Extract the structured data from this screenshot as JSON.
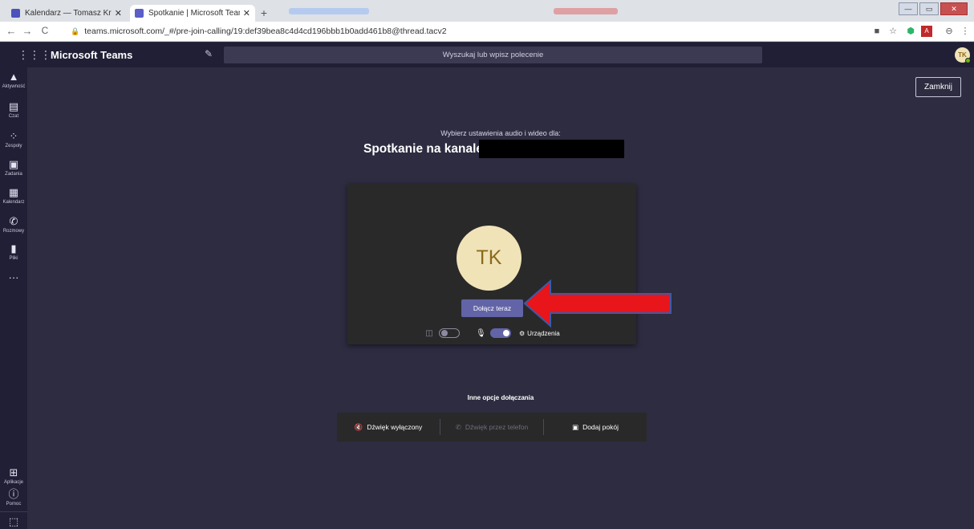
{
  "browser": {
    "tabs": [
      {
        "title": "Kalendarz — Tomasz Kretowicz -",
        "favicon_color": "#4b53bc",
        "active": false
      },
      {
        "title": "Spotkanie | Microsoft Teams",
        "favicon_color": "#5b5fc7",
        "active": true
      }
    ],
    "new_tab": "+",
    "url": "teams.microsoft.com/_#/pre-join-calling/19:def39bea8c4d4cd196bbb1b0add461b8@thread.tacv2"
  },
  "teams": {
    "brand": "Microsoft Teams",
    "search_placeholder": "Wyszukaj lub wpisz polecenie",
    "user_initials": "TK",
    "rail": [
      {
        "label": "Aktywność",
        "icon": "bell-icon",
        "glyph": "🔔"
      },
      {
        "label": "Czat",
        "icon": "chat-icon",
        "glyph": "💬"
      },
      {
        "label": "Zespoły",
        "icon": "teams-icon",
        "glyph": "👥"
      },
      {
        "label": "Zadania",
        "icon": "tasks-icon",
        "glyph": "🗒"
      },
      {
        "label": "Kalendarz",
        "icon": "calendar-icon",
        "glyph": "📅"
      },
      {
        "label": "Rozmowy",
        "icon": "phone-icon",
        "glyph": "📞"
      },
      {
        "label": "Pliki",
        "icon": "files-icon",
        "glyph": "📄"
      },
      {
        "label": "",
        "icon": "more-icon",
        "glyph": "···"
      }
    ],
    "rail_bottom": [
      {
        "label": "Aplikacje",
        "icon": "apps-icon",
        "glyph": "⊞"
      },
      {
        "label": "Pomoc",
        "icon": "help-icon",
        "glyph": "?"
      }
    ]
  },
  "prejoin": {
    "close_label": "Zamknij",
    "prompt": "Wybierz ustawienia audio i wideo dla:",
    "meeting_title": "Spotkanie na kanale",
    "avatar_initials": "TK",
    "join_label": "Dołącz teraz",
    "devices_label": "Urządzenia",
    "video_on": false,
    "mic_on": true,
    "other_options_title": "Inne opcje dołączania",
    "options": [
      {
        "label": "Dźwięk wyłączony",
        "icon": "speaker-off-icon",
        "enabled": true
      },
      {
        "label": "Dźwięk przez telefon",
        "icon": "phone-icon",
        "enabled": false
      },
      {
        "label": "Dodaj pokój",
        "icon": "room-icon",
        "enabled": true
      }
    ]
  },
  "colors": {
    "accent": "#6264a7",
    "background": "#2d2c40",
    "rail": "#201f35",
    "arrow": "#e8151b"
  }
}
